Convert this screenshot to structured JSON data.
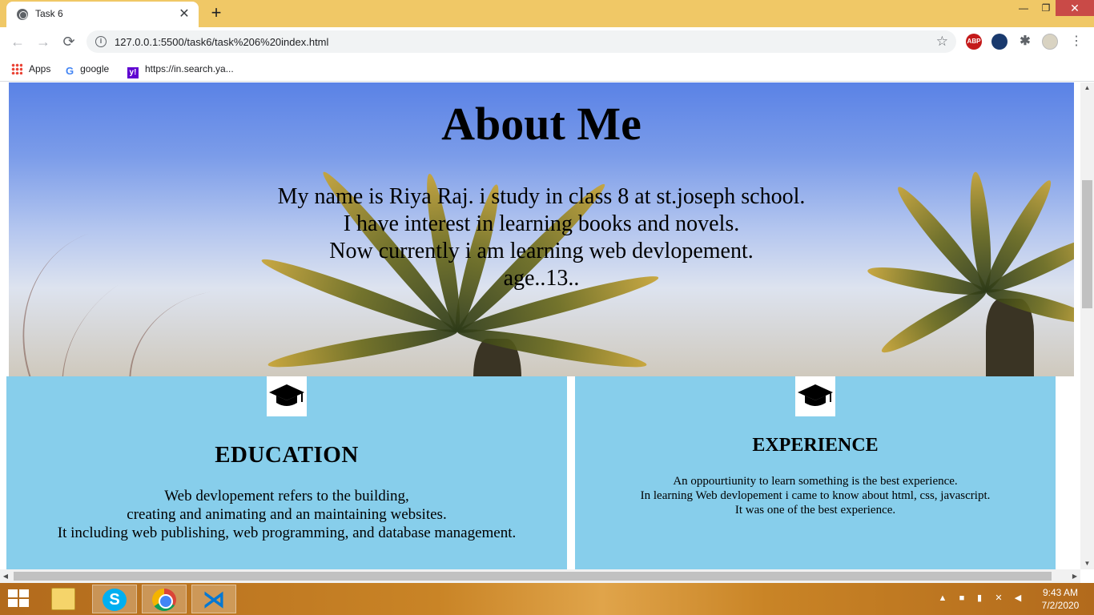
{
  "browser": {
    "tab": {
      "title": "Task 6",
      "close": "✕"
    },
    "new_tab": "+",
    "window_controls": {
      "minimize": "—",
      "maximize": "❐",
      "close": "✕"
    },
    "nav": {
      "back": "←",
      "forward": "→",
      "reload": "⟳"
    },
    "address": {
      "url": "127.0.0.1:5500/task6/task%206%20index.html",
      "info": "i",
      "star": "☆"
    },
    "extensions": [
      {
        "name": "adblock-plus",
        "label": "ABP"
      },
      {
        "name": "search-lens",
        "label": ""
      },
      {
        "name": "extensions-puzzle",
        "label": "✱"
      },
      {
        "name": "profile-avatar",
        "label": ""
      }
    ],
    "menu": "⋮",
    "bookmarks": [
      {
        "label": "Apps",
        "icon": "apps-grid-icon"
      },
      {
        "label": "google",
        "icon": "google-icon",
        "glyph": "G"
      },
      {
        "label": "https://in.search.ya...",
        "icon": "yahoo-icon",
        "glyph": "y!"
      }
    ]
  },
  "page": {
    "hero": {
      "title": "About Me",
      "lines": [
        "My name is Riya Raj. i study in class 8 at st.joseph school.",
        "I have interest in learning books and novels.",
        "Now currently i am learning web devlopement.",
        "age..13.."
      ]
    },
    "education": {
      "icon": "graduation-cap-icon",
      "title": "EDUCATION",
      "lines": [
        "Web devlopement refers to the building,",
        "creating and animating and an maintaining websites.",
        "It including web publishing, web programming, and database management."
      ]
    },
    "experience": {
      "icon": "graduation-cap-icon",
      "title": "EXPERIENCE",
      "lines": [
        "An oppourtiunity to learn something is the best experience.",
        "In learning Web devlopement i came to know about html, css, javascript.",
        "It was one of the best experience."
      ]
    },
    "colors": {
      "card_bg": "#87ceeb",
      "tab_strip": "#f0c866"
    }
  },
  "taskbar": {
    "apps": [
      "File Explorer",
      "Skype",
      "Google Chrome",
      "Visual Studio Code"
    ],
    "skype_glyph": "S",
    "vscode_glyph": "⋊",
    "clock": {
      "time": "9:43 AM",
      "date": "7/2/2020"
    }
  }
}
